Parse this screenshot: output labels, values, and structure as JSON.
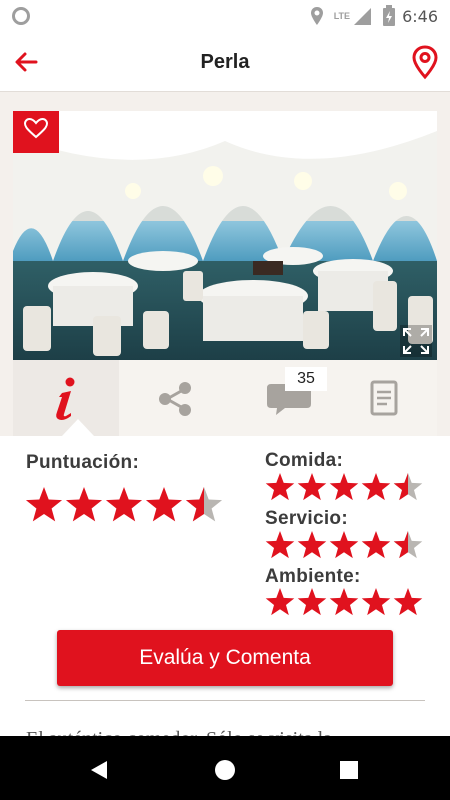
{
  "status_bar": {
    "time": "6:46",
    "network": "LTE"
  },
  "header": {
    "title": "Perla",
    "back_icon": "back-arrow-icon",
    "location_icon": "map-pin-icon"
  },
  "photo": {
    "description_icon": "restaurant-photo",
    "favorite_icon": "heart-icon",
    "expand_icon": "fullscreen-icon"
  },
  "tabs": {
    "info_icon": "info-icon",
    "share_icon": "share-icon",
    "comments_icon": "comment-icon",
    "comments_count": "35",
    "menu_icon": "document-icon"
  },
  "ratings": {
    "overall_label": "Puntuación:",
    "overall_value": 4.5,
    "food_label": "Comida:",
    "food_value": 4.5,
    "service_label": "Servicio:",
    "service_value": 4.5,
    "ambience_label": "Ambiente:",
    "ambience_value": 5,
    "max": 5
  },
  "cta_label": "Evalúa y Comenta",
  "description": "El auténtico comedor. Sólo se visita la",
  "colors": {
    "accent": "#e0121e",
    "star_empty": "#b9b6b2",
    "icon_gray": "#a7a39e"
  }
}
